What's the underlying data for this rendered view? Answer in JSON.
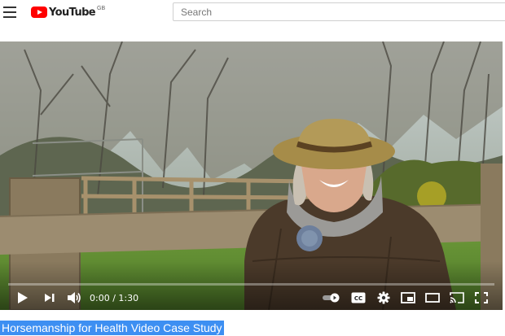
{
  "header": {
    "logo_text": "YouTube",
    "logo_country": "GB",
    "search_placeholder": "Search"
  },
  "player": {
    "current_time": "0:00",
    "separator": " / ",
    "duration": "1:30",
    "progress_fraction": 0,
    "icons": [
      "play-icon",
      "next-icon",
      "volume-icon",
      "autoplay-toggle-icon",
      "captions-icon",
      "settings-icon",
      "miniplayer-icon",
      "theater-icon",
      "cast-icon",
      "fullscreen-icon"
    ],
    "captions_label": "CC"
  },
  "video": {
    "title": "Horsemanship for Health Video Case Study"
  },
  "colors": {
    "accent": "#ff0000",
    "selection": "#3d8ff2"
  }
}
